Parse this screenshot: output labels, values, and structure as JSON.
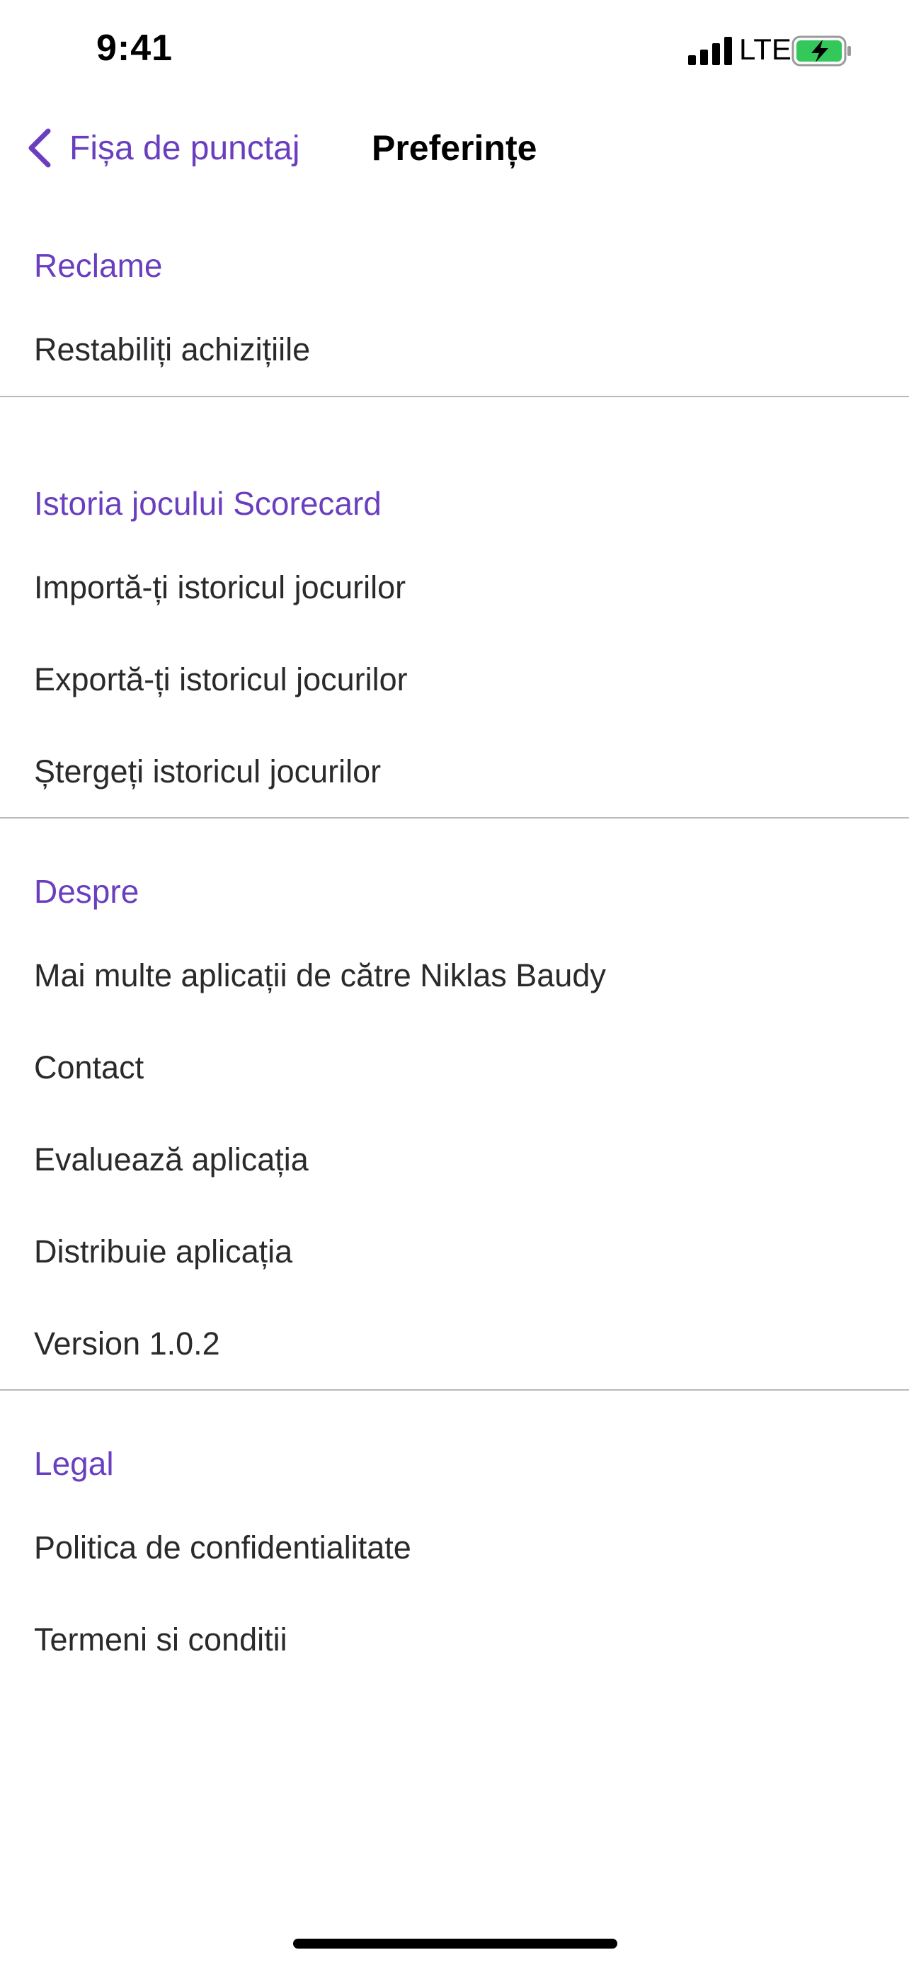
{
  "status_bar": {
    "time": "9:41",
    "network": "LTE"
  },
  "nav": {
    "back_label": "Fișa de punctaj",
    "title": "Preferințe"
  },
  "colors": {
    "accent": "#6a3fbf",
    "battery_fill": "#34c759",
    "divider": "#b9b9bb"
  },
  "icons": {
    "back": "chevron-left-icon",
    "signal": "cellular-signal-icon",
    "battery": "battery-charging-icon"
  },
  "sections": [
    {
      "header": "Reclame",
      "items": [
        "Restabiliți achizițiile"
      ]
    },
    {
      "header": "Istoria jocului Scorecard",
      "items": [
        "Importă-ți istoricul jocurilor",
        "Exportă-ți istoricul jocurilor",
        "Ștergeți istoricul jocurilor"
      ]
    },
    {
      "header": "Despre",
      "items": [
        "Mai multe aplicații de către Niklas Baudy",
        "Contact",
        "Evaluează aplicația",
        "Distribuie aplicația",
        "Version 1.0.2"
      ]
    },
    {
      "header": "Legal",
      "items": [
        "Politica de confidentialitate",
        "Termeni si conditii"
      ]
    }
  ]
}
